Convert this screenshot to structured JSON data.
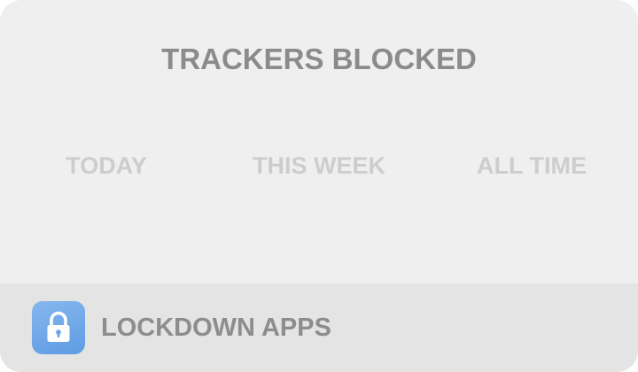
{
  "widget": {
    "title": "TRACKERS BLOCKED",
    "periods": [
      {
        "label": "TODAY"
      },
      {
        "label": "THIS WEEK"
      },
      {
        "label": "ALL TIME"
      }
    ]
  },
  "footer": {
    "icon": "lock-icon",
    "label": "LOCKDOWN APPS"
  },
  "colors": {
    "background": "#efefef",
    "footer_background": "#e4e4e4",
    "title": "#8b8b8b",
    "period_label": "#cdcdcd",
    "icon_gradient_top": "#86b7ee",
    "icon_gradient_bottom": "#5e9be3"
  }
}
